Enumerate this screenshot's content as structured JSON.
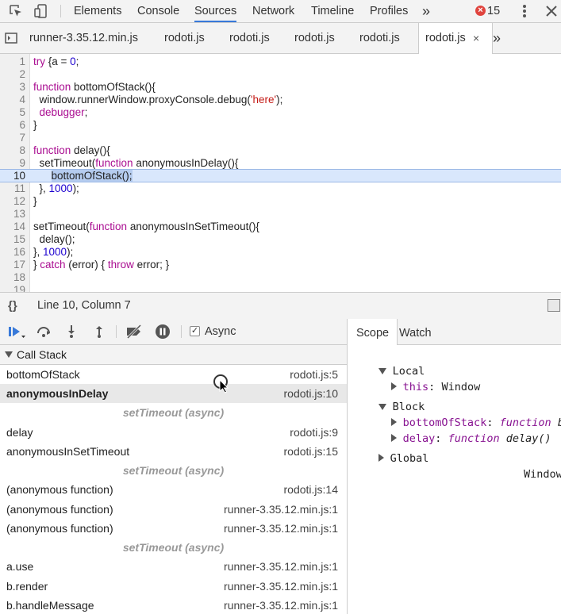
{
  "toolbar": {
    "tabs": [
      {
        "label": "Elements"
      },
      {
        "label": "Console"
      },
      {
        "label": "Sources"
      },
      {
        "label": "Network"
      },
      {
        "label": "Timeline"
      },
      {
        "label": "Profiles"
      }
    ],
    "more_label": "»",
    "error_count": "15"
  },
  "file_tabs": [
    {
      "label": "runner-3.35.12.min.js"
    },
    {
      "label": "rodoti.js"
    },
    {
      "label": "rodoti.js"
    },
    {
      "label": "rodoti.js"
    },
    {
      "label": "rodoti.js"
    },
    {
      "label": "rodoti.js"
    }
  ],
  "file_tabs_more": "»",
  "editor": {
    "line_numbers": [
      "1",
      "2",
      "3",
      "4",
      "5",
      "6",
      "7",
      "8",
      "9",
      "10",
      "11",
      "12",
      "13",
      "14",
      "15",
      "16",
      "17",
      "18",
      "19"
    ],
    "current_line": "10"
  },
  "status": {
    "position": "Line 10, Column 7",
    "braces": "{}"
  },
  "debugger": {
    "async_label": "Async",
    "async_checked": true
  },
  "call_stack": {
    "title": "Call Stack",
    "frames": [
      {
        "name": "bottomOfStack",
        "location": "rodoti.js:5"
      },
      {
        "name": "anonymousInDelay",
        "location": "rodoti.js:10"
      },
      {
        "async": "setTimeout (async)"
      },
      {
        "name": "delay",
        "location": "rodoti.js:9"
      },
      {
        "name": "anonymousInSetTimeout",
        "location": "rodoti.js:15"
      },
      {
        "async": "setTimeout (async)"
      },
      {
        "name": "(anonymous function)",
        "location": "rodoti.js:14"
      },
      {
        "name": "(anonymous function)",
        "location": "runner-3.35.12.min.js:1"
      },
      {
        "name": "(anonymous function)",
        "location": "runner-3.35.12.min.js:1"
      },
      {
        "async": "setTimeout (async)"
      },
      {
        "name": "a.use",
        "location": "runner-3.35.12.min.js:1"
      },
      {
        "name": "b.render",
        "location": "runner-3.35.12.min.js:1"
      },
      {
        "name": "b.handleMessage",
        "location": "runner-3.35.12.min.js:1"
      }
    ]
  },
  "scope": {
    "tabs": [
      {
        "label": "Scope"
      },
      {
        "label": "Watch"
      }
    ],
    "local_label": "Local",
    "this_key": "this",
    "this_value": "Window",
    "block_label": "Block",
    "block_items": [
      {
        "key": "bottomOfStack",
        "kw": "function",
        "value": "botto"
      },
      {
        "key": "delay",
        "kw": "function",
        "value": "delay()"
      }
    ],
    "global_label": "Global",
    "global_value": "Window"
  },
  "colors": {
    "accent": "#3879d9",
    "keyword": "#aa0d91",
    "number": "#1c00cf",
    "string": "#c41a16",
    "error": "#e0443e",
    "highlight": "#d9e7fc"
  }
}
